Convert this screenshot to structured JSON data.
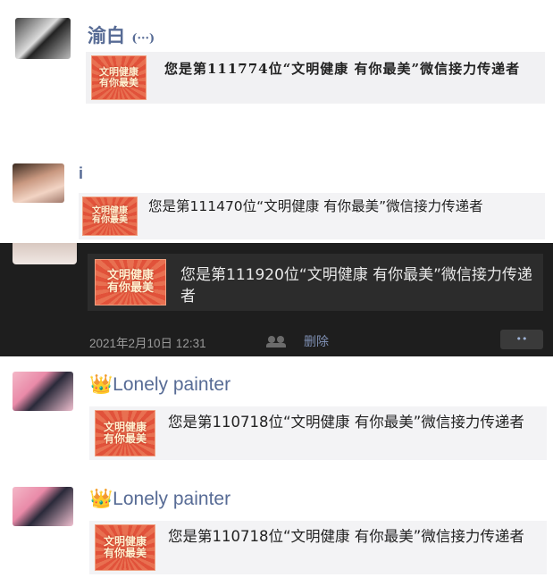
{
  "thumb_text": {
    "line1": "文明健康",
    "line2": "有你最美"
  },
  "posts": [
    {
      "name": "渝白",
      "name_suffix": "(···)",
      "message": "您是第111774位“文明健康 有你最美”微信接力传递者"
    },
    {
      "name": "i",
      "message": "您是第111470位“文明健康 有你最美”微信接力传递者"
    },
    {
      "message": "您是第111920位“文明健康 有你最美”微信接力传递者",
      "timestamp": "2021年2月10日 12:31",
      "delete_label": "删除",
      "more_label": "••"
    },
    {
      "name_emoji": "👑",
      "name": "Lonely painter",
      "message": "您是第110718位“文明健康 有你最美”微信接力传递者"
    },
    {
      "name_emoji": "👑",
      "name": "Lonely painter",
      "message": "您是第110718位“文明健康 有你最美”微信接力传递者"
    }
  ],
  "colors": {
    "dark_bg": "#1e1e1e",
    "name_blue": "#576b95",
    "thumb_red": "#e1523a"
  }
}
